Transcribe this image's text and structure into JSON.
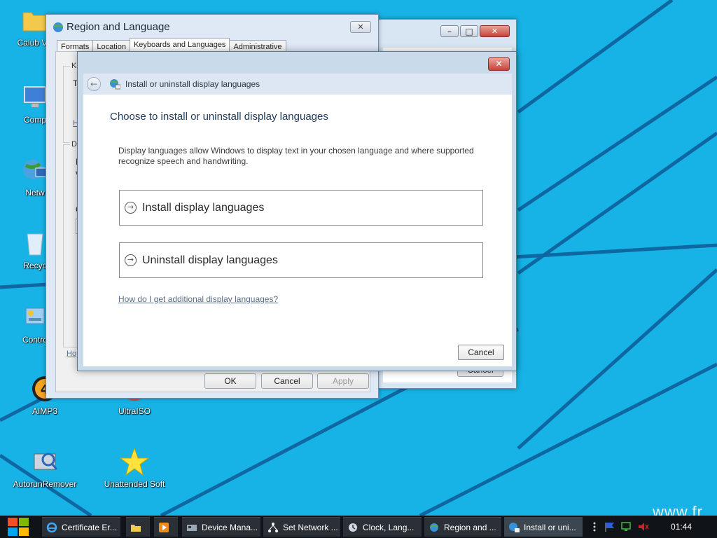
{
  "desktop": {
    "icons": [
      {
        "label": "Calub VK",
        "icon": "folder-icon"
      },
      {
        "label": "Comp",
        "icon": "computer-icon"
      },
      {
        "label": "Netw",
        "icon": "network-icon"
      },
      {
        "label": "Recyc",
        "icon": "recycle-bin-icon"
      },
      {
        "label": "Contro",
        "icon": "control-panel-icon"
      },
      {
        "label": "AIMP3",
        "icon": "aimp-icon"
      },
      {
        "label": "UltraISO",
        "icon": "ultraiso-icon"
      },
      {
        "label": "AutorunRemover",
        "icon": "autorun-remover-icon"
      },
      {
        "label": "Unattended Soft",
        "icon": "star-icon"
      }
    ],
    "watermark": "www.fr"
  },
  "region_window": {
    "title": "Region and Language",
    "close_label": "✕",
    "tabs": [
      "Formats",
      "Location",
      "Keyboards and Languages",
      "Administrative"
    ],
    "partial": [
      "Ke",
      "T",
      "H",
      "Di",
      "I",
      "v",
      "C",
      "Ho"
    ],
    "ok": "OK",
    "cancel": "Cancel",
    "apply": "Apply"
  },
  "control_window": {
    "minimize_label": "–",
    "maximize_label": "□",
    "close_label": "✕",
    "cancel": "Cancel"
  },
  "dialog": {
    "close_label": "✕",
    "back_label": "←",
    "nav_title": "Install or uninstall display languages",
    "heading": "Choose to install or uninstall display languages",
    "description": "Display languages allow Windows to display text in your chosen language and where supported recognize speech and handwriting.",
    "arrow_glyph": "→",
    "install_label": "Install display languages",
    "uninstall_label": "Uninstall display languages",
    "help_link": "How do I get additional display languages?",
    "cancel": "Cancel"
  },
  "taskbar": {
    "items": [
      {
        "label": "Certificate Er...",
        "icon": "ie-icon"
      },
      {
        "label": "",
        "icon": "explorer-folder-icon"
      },
      {
        "label": "",
        "icon": "media-player-icon"
      },
      {
        "label": "Device Mana...",
        "icon": "device-manager-icon"
      },
      {
        "label": "Set Network ...",
        "icon": "network-icon"
      },
      {
        "label": "Clock, Lang...",
        "icon": "clock-language-icon"
      },
      {
        "label": "Region and ...",
        "icon": "region-icon"
      },
      {
        "label": "Install or uni...",
        "icon": "install-language-icon"
      }
    ],
    "clock": "01:44"
  },
  "colors": {
    "desktop": "#17b3e6",
    "taskbar": "#101418",
    "dialog_heading": "#1e3a5c",
    "close_red": "#c6443a"
  }
}
